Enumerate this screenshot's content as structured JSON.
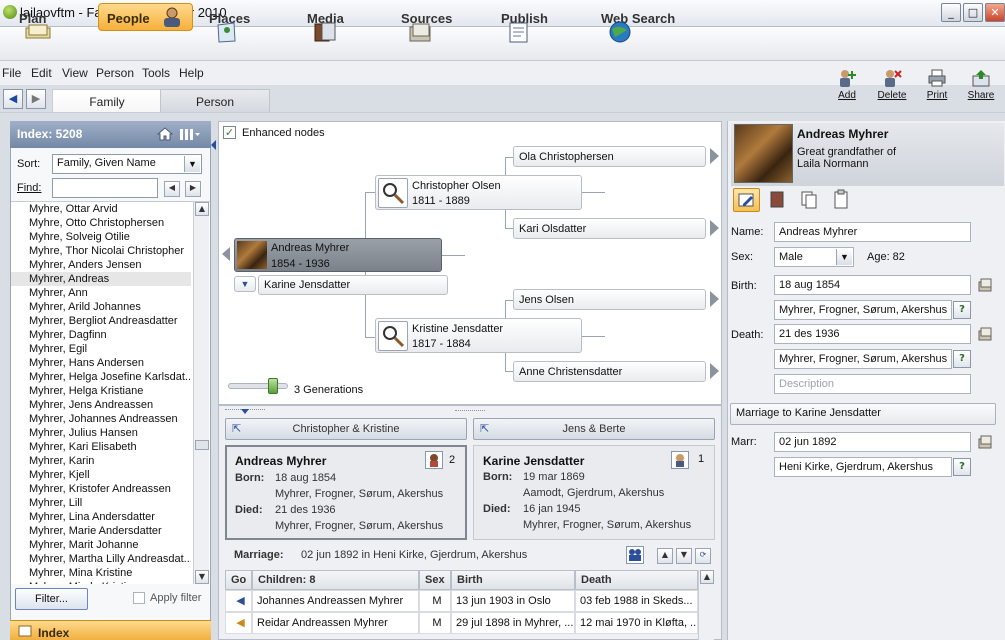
{
  "window": {
    "title": "lailaovftm - Family Tree Maker 2010",
    "min": "_",
    "max": "□",
    "close": "✕"
  },
  "workspaces": [
    {
      "label": "Plan"
    },
    {
      "label": "People"
    },
    {
      "label": "Places"
    },
    {
      "label": "Media"
    },
    {
      "label": "Sources"
    },
    {
      "label": "Publish"
    },
    {
      "label": "Web Search"
    }
  ],
  "menus": [
    "File",
    "Edit",
    "View",
    "Person",
    "Tools",
    "Help"
  ],
  "toolbar": {
    "add": "Add",
    "delete": "Delete",
    "print": "Print",
    "share": "Share"
  },
  "view_tabs": {
    "family": "Family",
    "person": "Person"
  },
  "index": {
    "title": "Index: 5208",
    "sort_label": "Sort:",
    "sort_value": "Family, Given Name",
    "find_label": "Find:",
    "find_value": "",
    "names": [
      "Myhre, Ottar Arvid",
      "Myhre, Otto Christophersen",
      "Myhre, Solveig Otilie",
      "Myhre, Thor Nicolai Christopher",
      "Myhrer, Anders Jensen",
      "Myhrer, Andreas",
      "Myhrer, Ann",
      "Myhrer, Arild Johannes",
      "Myhrer, Bergliot Andreasdatter",
      "Myhrer, Dagfinn",
      "Myhrer, Egil",
      "Myhrer, Hans Andersen",
      "Myhrer, Helga Josefine Karlsdat...",
      "Myhrer, Helga Kristiane",
      "Myhrer, Jens Andreassen",
      "Myhrer, Johannes Andreassen",
      "Myhrer, Julius Hansen",
      "Myhrer, Kari Elisabeth",
      "Myhrer, Karin",
      "Myhrer, Kjell",
      "Myhrer, Kristofer Andreassen",
      "Myhrer, Lill",
      "Myhrer, Lina Andersdatter",
      "Myhrer, Marie Andersdatter",
      "Myhrer, Marit Johanne",
      "Myhrer, Martha Lilly Andreasdat...",
      "Myhrer, Mina Kristine",
      "Myhrer, Minda Kristine"
    ],
    "selected_index": 5,
    "filter_button": "Filter...",
    "apply_filter": "Apply filter",
    "footer": "Index"
  },
  "tree": {
    "enhanced_nodes_label": "Enhanced nodes",
    "enhanced_checked": true,
    "generations_label": "3 Generations",
    "generations_level": 0.75,
    "focus": {
      "name": "Andreas Myhrer",
      "years": "1854 - 1936"
    },
    "spouse": "Karine Jensdatter",
    "father": {
      "name": "Christopher Olsen",
      "years": "1811 - 1889"
    },
    "mother": {
      "name": "Kristine Jensdatter",
      "years": "1817 - 1884"
    },
    "pgf": "Ola Christophersen",
    "pgm": "Kari Olsdatter",
    "mgf": "Jens Olsen",
    "mgm": "Anne Christensdatter"
  },
  "family": {
    "parents_tab1": "Christopher & Kristine",
    "parents_tab2": "Jens & Berte",
    "person1": {
      "name": "Andreas Myhrer",
      "born_label": "Born:",
      "born_date": "18 aug 1854",
      "born_place": "Myhrer, Frogner, Sørum, Akershus",
      "died_label": "Died:",
      "died_date": "21 des 1936",
      "died_place": "Myhrer, Frogner, Sørum, Akershus",
      "spouse_count": "2"
    },
    "person2": {
      "name": "Karine Jensdatter",
      "born_label": "Born:",
      "born_date": "19 mar 1869",
      "born_place": "Aamodt, Gjerdrum, Akershus",
      "died_label": "Died:",
      "died_date": "16 jan 1945",
      "died_place": "Myhrer, Frogner, Sørum, Akershus",
      "spouse_count": "1"
    },
    "marriage_label": "Marriage:",
    "marriage_text": "02 jun 1892 in Heni Kirke, Gjerdrum, Akershus",
    "children_headers": {
      "go": "Go",
      "children": "Children: 8",
      "sex": "Sex",
      "birth": "Birth",
      "death": "Death"
    },
    "children": [
      {
        "name": "Johannes Andreassen Myhrer",
        "sex": "M",
        "birth": "13 jun 1903 in Oslo",
        "death": "03 feb 1988 in Skeds..."
      },
      {
        "name": "Reidar Andreassen Myhrer",
        "sex": "M",
        "birth": "29 jul 1898 in Myhrer, ...",
        "death": "12 mai 1970 in Kløfta, ..."
      }
    ]
  },
  "editor": {
    "name_heading": "Andreas Myhrer",
    "relation_line1": "Great grandfather of",
    "relation_line2": "Laila Normann",
    "name_label": "Name:",
    "name_value": "Andreas Myhrer",
    "sex_label": "Sex:",
    "sex_value": "Male",
    "age_text": "Age: 82",
    "birth_label": "Birth:",
    "birth_date": "18 aug 1854",
    "birth_place": "Myhrer, Frogner, Sørum, Akershus",
    "death_label": "Death:",
    "death_date": "21 des 1936",
    "death_place": "Myhrer, Frogner, Sørum, Akershus",
    "description_placeholder": "Description",
    "marriage_header": "Marriage to Karine Jensdatter",
    "marr_label": "Marr:",
    "marr_date": "02 jun 1892",
    "marr_place": "Heni Kirke, Gjerdrum, Akershus"
  }
}
